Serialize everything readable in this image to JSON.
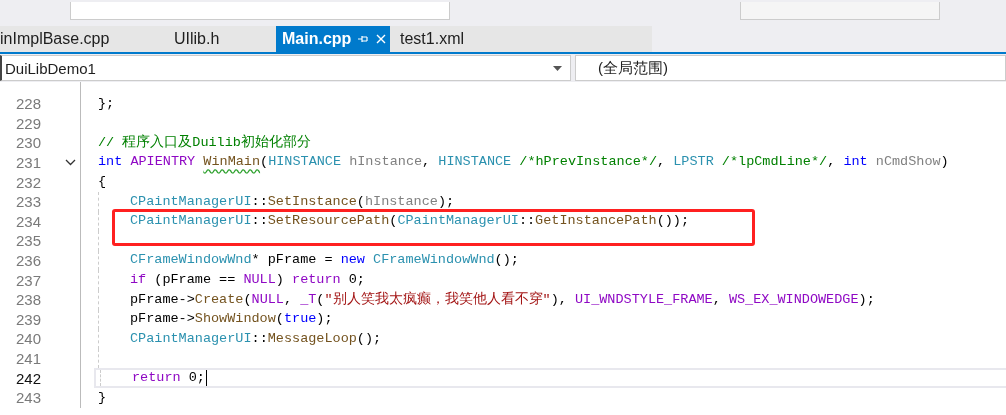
{
  "tabs": [
    {
      "label": "inImplBase.cpp",
      "selected": false
    },
    {
      "label": "UIlib.h",
      "selected": false
    },
    {
      "label": "Main.cpp",
      "selected": true
    },
    {
      "label": "test1.xml",
      "selected": false
    }
  ],
  "navigation": {
    "project": "DuiLibDemo1",
    "scope": "(全局范围)"
  },
  "code_lines": [
    {
      "number": "228",
      "current": false,
      "foldable": false,
      "indented": false,
      "tokens": [
        {
          "kind": "plain",
          "text": "};"
        }
      ]
    },
    {
      "number": "229",
      "current": false,
      "foldable": false,
      "indented": false
    },
    {
      "number": "230",
      "current": false,
      "foldable": false,
      "indented": false,
      "tokens": [
        {
          "kind": "comment",
          "text": "// 程序入口及Duilib初始化部分"
        }
      ]
    },
    {
      "number": "231",
      "current": false,
      "foldable": true,
      "indented": false,
      "tokens": [
        {
          "kind": "keyword",
          "text": "int "
        },
        {
          "kind": "macro",
          "text": "APIENTRY "
        },
        {
          "kind": "squiggled",
          "text": "WinMain"
        },
        {
          "kind": "plain",
          "text": "("
        },
        {
          "kind": "type",
          "text": "HINSTANCE "
        },
        {
          "kind": "param",
          "text": "hInstance"
        },
        {
          "kind": "plain",
          "text": ", "
        },
        {
          "kind": "type",
          "text": "HINSTANCE "
        },
        {
          "kind": "comment",
          "text": "/*hPrevInstance*/"
        },
        {
          "kind": "plain",
          "text": ", "
        },
        {
          "kind": "type",
          "text": "LPSTR "
        },
        {
          "kind": "comment",
          "text": "/*lpCmdLine*/"
        },
        {
          "kind": "plain",
          "text": ", "
        },
        {
          "kind": "keyword",
          "text": "int "
        },
        {
          "kind": "param",
          "text": "nCmdShow"
        },
        {
          "kind": "plain",
          "text": ")"
        }
      ]
    },
    {
      "number": "232",
      "current": false,
      "foldable": false,
      "indented": false,
      "tokens": [
        {
          "kind": "plain",
          "text": "{"
        }
      ]
    },
    {
      "number": "233",
      "current": false,
      "foldable": false,
      "indented": true,
      "tokens": [
        {
          "kind": "type",
          "text": "CPaintManagerUI"
        },
        {
          "kind": "plain",
          "text": "::"
        },
        {
          "kind": "func",
          "text": "SetInstance"
        },
        {
          "kind": "plain",
          "text": "("
        },
        {
          "kind": "param",
          "text": "hInstance"
        },
        {
          "kind": "plain",
          "text": ");"
        }
      ]
    },
    {
      "number": "234",
      "current": false,
      "foldable": false,
      "indented": true,
      "tokens": [
        {
          "kind": "type",
          "text": "CPaintManagerUI"
        },
        {
          "kind": "plain",
          "text": "::"
        },
        {
          "kind": "func",
          "text": "SetResourcePath"
        },
        {
          "kind": "plain",
          "text": "("
        },
        {
          "kind": "type",
          "text": "CPaintManagerUI"
        },
        {
          "kind": "plain",
          "text": "::"
        },
        {
          "kind": "func",
          "text": "GetInstancePath"
        },
        {
          "kind": "plain",
          "text": "());"
        }
      ]
    },
    {
      "number": "235",
      "current": false,
      "foldable": false,
      "indented": true
    },
    {
      "number": "236",
      "current": false,
      "foldable": false,
      "indented": true,
      "tokens": [
        {
          "kind": "type",
          "text": "CFrameWindowWnd"
        },
        {
          "kind": "plain",
          "text": "* pFrame = "
        },
        {
          "kind": "keyword",
          "text": "new "
        },
        {
          "kind": "type",
          "text": "CFrameWindowWnd"
        },
        {
          "kind": "plain",
          "text": "();"
        }
      ]
    },
    {
      "number": "237",
      "current": false,
      "foldable": false,
      "indented": true,
      "tokens": [
        {
          "kind": "macro",
          "text": "if"
        },
        {
          "kind": "plain",
          "text": " (pFrame == "
        },
        {
          "kind": "macro",
          "text": "NULL"
        },
        {
          "kind": "plain",
          "text": ") "
        },
        {
          "kind": "macro",
          "text": "return"
        },
        {
          "kind": "plain",
          "text": " 0;"
        }
      ]
    },
    {
      "number": "238",
      "current": false,
      "foldable": false,
      "indented": true,
      "tokens": [
        {
          "kind": "plain",
          "text": "pFrame->"
        },
        {
          "kind": "func",
          "text": "Create"
        },
        {
          "kind": "plain",
          "text": "("
        },
        {
          "kind": "macro",
          "text": "NULL"
        },
        {
          "kind": "plain",
          "text": ", "
        },
        {
          "kind": "macro",
          "text": "_T"
        },
        {
          "kind": "plain",
          "text": "("
        },
        {
          "kind": "string",
          "text": "\"别人笑我太疯癫，我笑他人看不穿\""
        },
        {
          "kind": "plain",
          "text": "), "
        },
        {
          "kind": "macro",
          "text": "UI_WNDSTYLE_FRAME"
        },
        {
          "kind": "plain",
          "text": ", "
        },
        {
          "kind": "macro",
          "text": "WS_EX_WINDOWEDGE"
        },
        {
          "kind": "plain",
          "text": ");"
        }
      ]
    },
    {
      "number": "239",
      "current": false,
      "foldable": false,
      "indented": true,
      "tokens": [
        {
          "kind": "plain",
          "text": "pFrame->"
        },
        {
          "kind": "func",
          "text": "ShowWindow"
        },
        {
          "kind": "plain",
          "text": "("
        },
        {
          "kind": "keyword",
          "text": "true"
        },
        {
          "kind": "plain",
          "text": ");"
        }
      ]
    },
    {
      "number": "240",
      "current": false,
      "foldable": false,
      "indented": true,
      "tokens": [
        {
          "kind": "type",
          "text": "CPaintManagerUI"
        },
        {
          "kind": "plain",
          "text": "::"
        },
        {
          "kind": "func",
          "text": "MessageLoop"
        },
        {
          "kind": "plain",
          "text": "();"
        }
      ]
    },
    {
      "number": "241",
      "current": false,
      "foldable": false,
      "indented": true
    },
    {
      "number": "242",
      "current": true,
      "foldable": false,
      "indented": true,
      "tokens": [
        {
          "kind": "macro",
          "text": "return"
        },
        {
          "kind": "plain",
          "text": " 0;"
        }
      ]
    },
    {
      "number": "243",
      "current": false,
      "foldable": false,
      "indented": false,
      "tokens": [
        {
          "kind": "plain",
          "text": "}"
        }
      ]
    }
  ]
}
